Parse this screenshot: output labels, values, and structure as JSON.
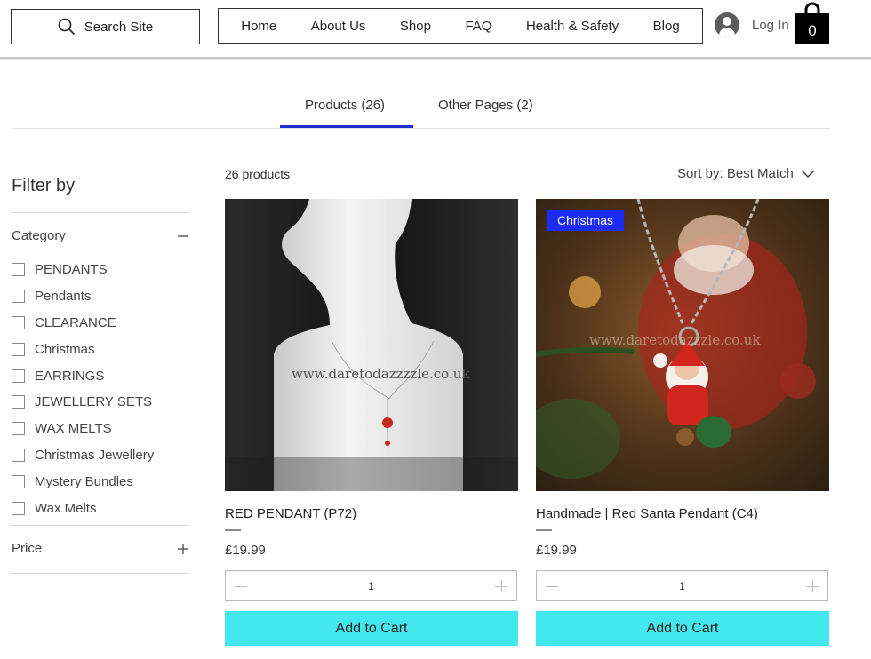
{
  "header": {
    "search_label": "Search Site",
    "nav": [
      "Home",
      "About Us",
      "Shop",
      "FAQ",
      "Health & Safety",
      "Blog"
    ],
    "login_label": "Log In",
    "cart_count": "0"
  },
  "tabs": {
    "products": "Products (26)",
    "other": "Other Pages (2)"
  },
  "sidebar": {
    "title": "Filter by",
    "category_label": "Category",
    "categories": [
      "PENDANTS",
      "Pendants",
      "CLEARANCE",
      "Christmas",
      "EARRINGS",
      "JEWELLERY SETS",
      "WAX MELTS",
      "Christmas Jewellery",
      "Mystery Bundles",
      "Wax Melts"
    ],
    "price_label": "Price"
  },
  "results": {
    "count": "26 products",
    "sort": "Sort by: Best Match"
  },
  "products": [
    {
      "name": "RED PENDANT (P72)",
      "price": "£19.99",
      "qty": "1",
      "add": "Add to Cart",
      "watermark": "www.daretodazzzzle.co.uk"
    },
    {
      "name": "Handmade | Red Santa Pendant (C4)",
      "price": "£19.99",
      "qty": "1",
      "add": "Add to Cart",
      "badge": "Christmas",
      "watermark": "www.daretodazzzle.co.uk"
    }
  ],
  "colors": {
    "accent_underline": "#1f2fd1",
    "add_to_cart": "#43e8ee",
    "badge": "#1a2cf0"
  }
}
